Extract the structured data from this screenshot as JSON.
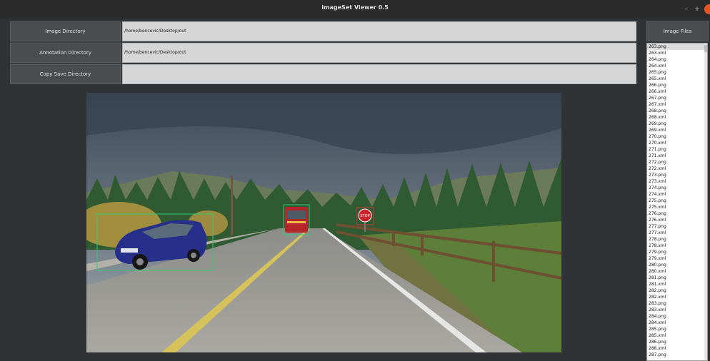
{
  "window": {
    "title": "ImageSet Viewer 0.5",
    "minimize_glyph": "–",
    "maximize_glyph": "+",
    "accent": "#e95420"
  },
  "form": {
    "image_dir_button": "Image Directory",
    "image_dir_value": "/home/bencevic/Desktop/out",
    "annotation_dir_button": "Annotation Directory",
    "annotation_dir_value": "/home/bencevic/Desktop/out",
    "copy_save_button": "Copy Save Directory",
    "copy_save_value": ""
  },
  "files": {
    "header": "Image Files",
    "items": [
      "263.png",
      "263.xml",
      "264.png",
      "264.xml",
      "265.png",
      "265.xml",
      "266.png",
      "266.xml",
      "267.png",
      "267.xml",
      "268.png",
      "268.xml",
      "269.png",
      "269.xml",
      "270.png",
      "270.xml",
      "271.png",
      "271.xml",
      "272.png",
      "272.xml",
      "273.png",
      "273.xml",
      "274.png",
      "274.xml",
      "275.png",
      "275.xml",
      "276.png",
      "276.xml",
      "277.png",
      "277.xml",
      "278.png",
      "278.xml",
      "279.png",
      "279.xml",
      "280.png",
      "280.xml",
      "281.png",
      "281.xml",
      "282.png",
      "282.xml",
      "283.png",
      "283.xml",
      "284.png",
      "284.xml",
      "285.png",
      "285.xml",
      "286.png",
      "286.xml",
      "287.png"
    ],
    "selected_index": 0
  },
  "scene": {
    "stop_sign_text": "STOP"
  }
}
